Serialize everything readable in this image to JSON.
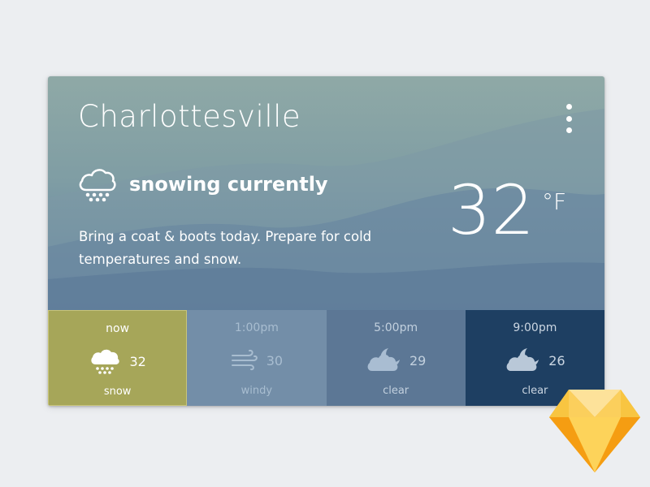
{
  "city": "Charlottesville",
  "menu_icon": "more-vertical-icon",
  "condition": {
    "icon": "snow-cloud-icon",
    "label": "snowing currently",
    "advice": "Bring a coat & boots today. Prepare for cold temperatures and snow."
  },
  "current": {
    "temp": "32",
    "unit": "°F"
  },
  "forecast": [
    {
      "time": "now",
      "temp": "32",
      "desc": "snow",
      "icon": "snow-cloud-icon",
      "color": "#a6a659"
    },
    {
      "time": "1:00pm",
      "temp": "30",
      "desc": "windy",
      "icon": "wind-icon",
      "color": "#738ea8"
    },
    {
      "time": "5:00pm",
      "temp": "29",
      "desc": "clear",
      "icon": "cloud-moon-icon",
      "color": "#5c7795"
    },
    {
      "time": "9:00pm",
      "temp": "26",
      "desc": "clear",
      "icon": "cloud-moon-icon",
      "color": "#1e3f62"
    }
  ],
  "brand_icon": "sketch-logo-icon"
}
